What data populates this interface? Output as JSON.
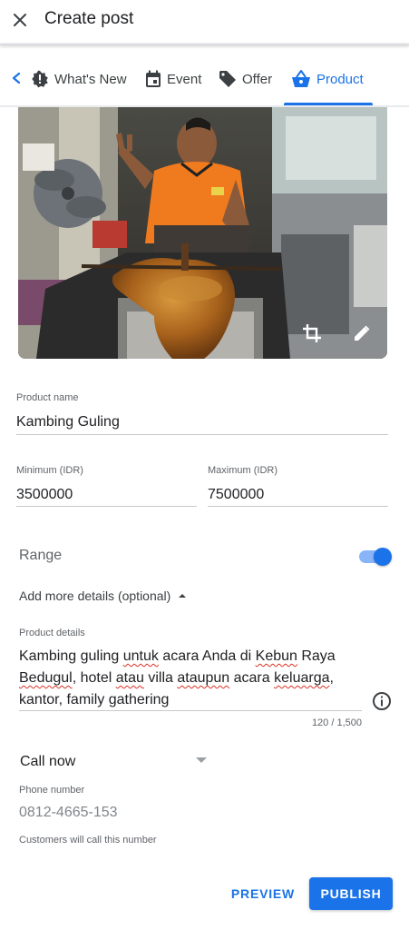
{
  "header": {
    "title": "Create post",
    "close_icon": "close-icon"
  },
  "tabs": {
    "items": [
      {
        "label": "What's New",
        "icon": "whats-new-icon",
        "active": false
      },
      {
        "label": "Event",
        "icon": "calendar-icon",
        "active": false
      },
      {
        "label": "Offer",
        "icon": "tag-icon",
        "active": false
      },
      {
        "label": "Product",
        "icon": "shopping-basket-icon",
        "active": true
      }
    ],
    "accent": "#1a73e8"
  },
  "photo": {
    "crop_icon": "crop-icon",
    "edit_icon": "pencil-icon"
  },
  "form": {
    "product_name": {
      "label": "Product name",
      "value": "Kambing Guling"
    },
    "minimum": {
      "label": "Minimum (IDR)",
      "value": "3500000"
    },
    "maximum": {
      "label": "Maximum (IDR)",
      "value": "7500000"
    },
    "range": {
      "label": "Range",
      "enabled": true
    },
    "more_details": {
      "label": "Add more details (optional)"
    },
    "product_details": {
      "label": "Product details",
      "parts": [
        "Kambing guling ",
        "untuk",
        " acara Anda di ",
        "Kebun",
        " Raya ",
        "Bedugul",
        ", hotel ",
        "atau",
        " villa ",
        "ataupun",
        " acara ",
        "keluarga",
        ", kantor, family gathering"
      ],
      "counter": "120 / 1,500"
    },
    "call_to_action": {
      "value": "Call now"
    },
    "phone": {
      "label": "Phone number",
      "value": "0812-4665-153",
      "helper": "Customers will call this number"
    }
  },
  "actions": {
    "preview": "PREVIEW",
    "publish": "PUBLISH"
  }
}
